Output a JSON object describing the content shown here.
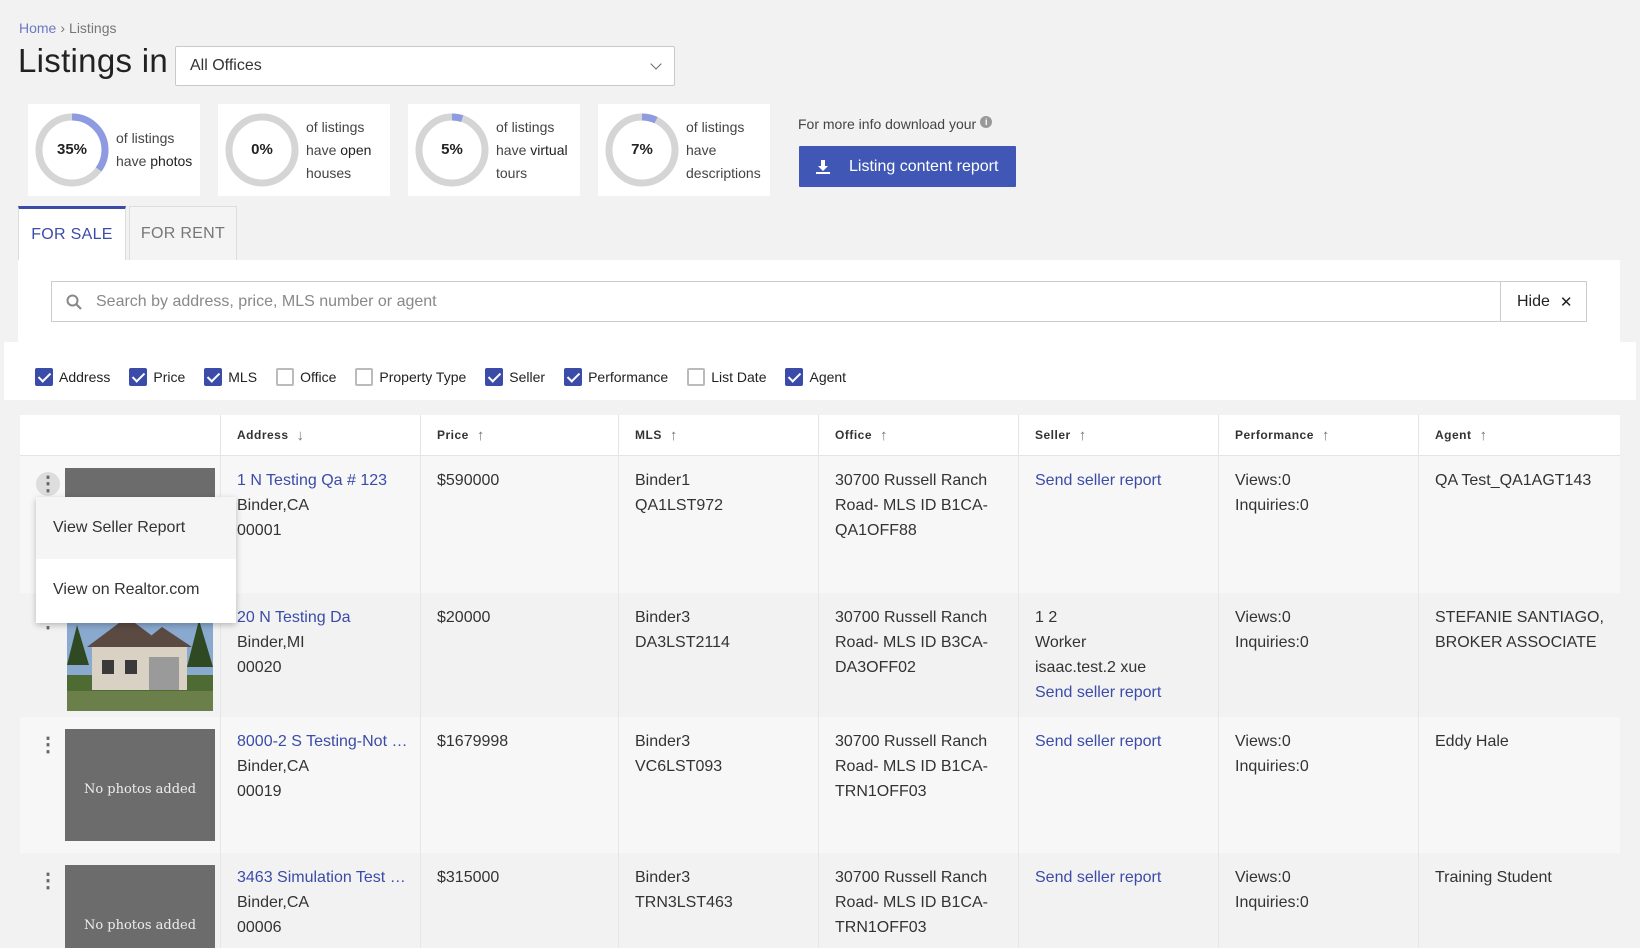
{
  "breadcrumb": {
    "home": "Home",
    "separator": "›",
    "current": "Listings"
  },
  "page_title": "Listings in",
  "office_select": {
    "value": "All Offices"
  },
  "stats": [
    {
      "pct": "35%",
      "value": 0.35,
      "line1": "of listings",
      "line2_prefix": "have ",
      "line2_bold": "photos",
      "line3": ""
    },
    {
      "pct": "0%",
      "value": 0.0,
      "line1": "of listings",
      "line2_prefix": "have ",
      "line2_bold": "open",
      "line3": "houses"
    },
    {
      "pct": "5%",
      "value": 0.05,
      "line1": "of listings",
      "line2_prefix": "have ",
      "line2_bold": "virtual",
      "line3": "tours"
    },
    {
      "pct": "7%",
      "value": 0.07,
      "line1": "of listings",
      "line2_prefix": "have",
      "line2_bold": "",
      "line3": "descriptions"
    }
  ],
  "info_text": "For more info download your",
  "report_button": "Listing content report",
  "tabs": {
    "for_sale": "FOR SALE",
    "for_rent": "FOR RENT"
  },
  "search": {
    "placeholder": "Search by address, price, MLS number or agent"
  },
  "hide_button": "Hide",
  "filters": [
    {
      "label": "Address",
      "checked": true
    },
    {
      "label": "Price",
      "checked": true
    },
    {
      "label": "MLS",
      "checked": true
    },
    {
      "label": "Office",
      "checked": false
    },
    {
      "label": "Property Type",
      "checked": false
    },
    {
      "label": "Seller",
      "checked": true
    },
    {
      "label": "Performance",
      "checked": true
    },
    {
      "label": "List Date",
      "checked": false
    },
    {
      "label": "Agent",
      "checked": true
    }
  ],
  "columns": {
    "address": "Address",
    "price": "Price",
    "mls": "MLS",
    "office": "Office",
    "seller": "Seller",
    "performance": "Performance",
    "agent": "Agent"
  },
  "sort_arrows": {
    "down": "↓",
    "up": "↑"
  },
  "no_photos": "No photos added",
  "send_report": "Send seller report",
  "rows": [
    {
      "address": "1 N Testing Qa # 123",
      "city": "Binder,CA",
      "zip": "00001",
      "price": "$590000",
      "mls1": "Binder1",
      "mls2": "QA1LST972",
      "office1": "30700 Russell Ranch",
      "office2": "Road- MLS ID B1CA-",
      "office3": "QA1OFF88",
      "views": "Views:0",
      "inquiries": "Inquiries:0",
      "agent1": "QA Test_QA1AGT143",
      "agent2": ""
    },
    {
      "address": "20 N Testing Da",
      "city": "Binder,MI",
      "zip": "00020",
      "price": "$20000",
      "mls1": "Binder3",
      "mls2": "DA3LST2114",
      "office1": "30700 Russell Ranch",
      "office2": "Road- MLS ID B3CA-",
      "office3": "DA3OFF02",
      "seller1": "1 2",
      "seller2": "Worker",
      "seller3": "isaac.test.2 xue",
      "views": "Views:0",
      "inquiries": "Inquiries:0",
      "agent1": "STEFANIE SANTIAGO,",
      "agent2": "BROKER ASSOCIATE"
    },
    {
      "address": "8000-2 S Testing-Not …",
      "city": "Binder,CA",
      "zip": "00019",
      "price": "$1679998",
      "mls1": "Binder3",
      "mls2": "VC6LST093",
      "office1": "30700 Russell Ranch",
      "office2": "Road- MLS ID B1CA-",
      "office3": "TRN1OFF03",
      "views": "Views:0",
      "inquiries": "Inquiries:0",
      "agent1": "Eddy Hale",
      "agent2": ""
    },
    {
      "address": "3463 Simulation Test …",
      "city": "Binder,CA",
      "zip": "00006",
      "price": "$315000",
      "mls1": "Binder3",
      "mls2": "TRN3LST463",
      "office1": "30700 Russell Ranch",
      "office2": "Road- MLS ID B1CA-",
      "office3": "TRN1OFF03",
      "views": "Views:0",
      "inquiries": "Inquiries:0",
      "agent1": "Training Student",
      "agent2": ""
    }
  ],
  "context_menu": {
    "view_seller_report": "View Seller Report",
    "view_realtor": "View on Realtor.com"
  },
  "colors": {
    "accent": "#3b4ba8",
    "button": "#4057b5",
    "donut_fill": "#8f9be0",
    "donut_track": "#d5d5d5"
  }
}
